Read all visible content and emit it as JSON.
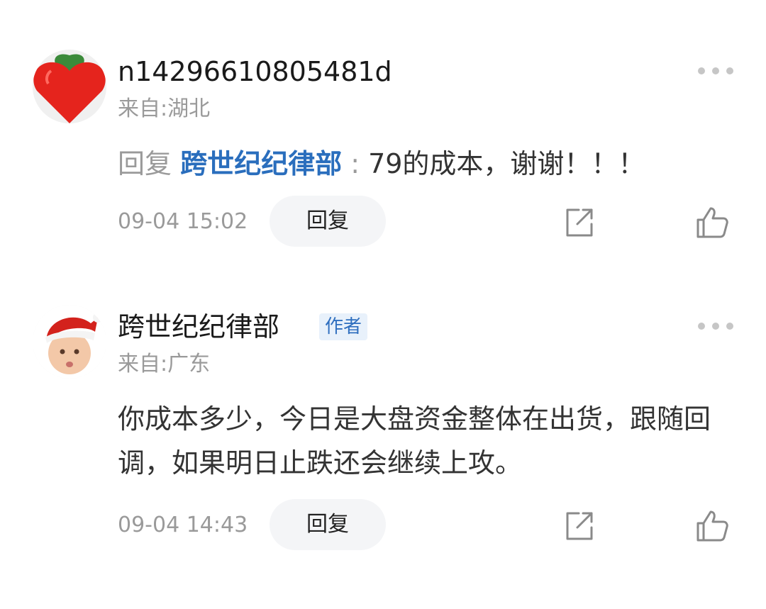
{
  "comments": [
    {
      "avatar_icon": "red-heart-avatar-icon",
      "username": "n14296610805481d",
      "location": "来自:湖北",
      "reply_prefix": "回复 ",
      "reply_target": "跨世纪纪律部",
      "reply_sep": " : ",
      "text": "79的成本，谢谢！！！",
      "timestamp": "09-04 15:02",
      "reply_label": "回复"
    },
    {
      "avatar_icon": "baby-santa-hat-avatar-icon",
      "username": "跨世纪纪律部",
      "author_badge": "作者",
      "location": "来自:广东",
      "text": "你成本多少，今日是大盘资金整体在出货，跟随回调，如果明日止跌还会继续上攻。",
      "timestamp": "09-04 14:43",
      "reply_label": "回复"
    }
  ],
  "icons": {
    "more": "more-dots-icon",
    "share": "share-icon",
    "like": "thumbs-up-icon"
  },
  "colors": {
    "link_blue": "#2a6ebd",
    "muted_gray": "#9a9a9a",
    "badge_bg": "#e8f1fb",
    "badge_text": "#2f6fbf",
    "button_bg": "#f4f5f7"
  }
}
